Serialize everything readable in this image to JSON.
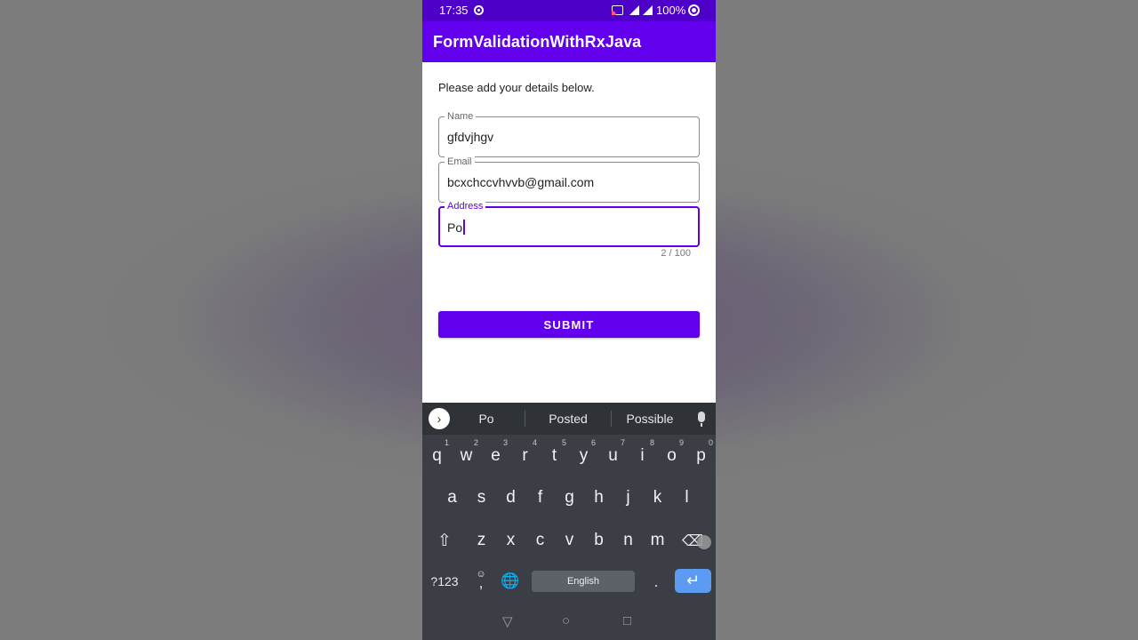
{
  "status_bar": {
    "time": "17:35",
    "battery": "100%"
  },
  "app_bar": {
    "title": "FormValidationWithRxJava"
  },
  "form": {
    "intro": "Please add your details below.",
    "name": {
      "label": "Name",
      "value": "gfdvjhgv"
    },
    "email": {
      "label": "Email",
      "value": "bcxchccvhvvb@gmail.com"
    },
    "address": {
      "label": "Address",
      "value": "Po",
      "counter": "2 / 100"
    },
    "submit_label": "SUBMIT"
  },
  "keyboard": {
    "suggestions": [
      "Po",
      "Posted",
      "Possible"
    ],
    "row1": [
      {
        "k": "q",
        "h": "1"
      },
      {
        "k": "w",
        "h": "2"
      },
      {
        "k": "e",
        "h": "3"
      },
      {
        "k": "r",
        "h": "4"
      },
      {
        "k": "t",
        "h": "5"
      },
      {
        "k": "y",
        "h": "6"
      },
      {
        "k": "u",
        "h": "7"
      },
      {
        "k": "i",
        "h": "8"
      },
      {
        "k": "o",
        "h": "9"
      },
      {
        "k": "p",
        "h": "0"
      }
    ],
    "row2": [
      "a",
      "s",
      "d",
      "f",
      "g",
      "h",
      "j",
      "k",
      "l"
    ],
    "row3": [
      "z",
      "x",
      "c",
      "v",
      "b",
      "n",
      "m"
    ],
    "symbols_label": "?123",
    "comma_label": ",",
    "comma_hint": "☺",
    "period_label": ".",
    "space_label": "English"
  },
  "icons": {
    "expand": "chevron-right-icon",
    "mic": "microphone-icon",
    "shift": "shift-icon",
    "backspace": "backspace-icon",
    "globe": "globe-icon",
    "enter": "enter-icon",
    "nav_back": "back-triangle-icon",
    "nav_home": "home-circle-icon",
    "nav_recents": "recents-square-icon"
  },
  "colors": {
    "primary": "#6200ee",
    "status_bar": "#4c00c8",
    "keyboard_bg": "#3b3f45",
    "enter_key": "#5b9bf2"
  }
}
